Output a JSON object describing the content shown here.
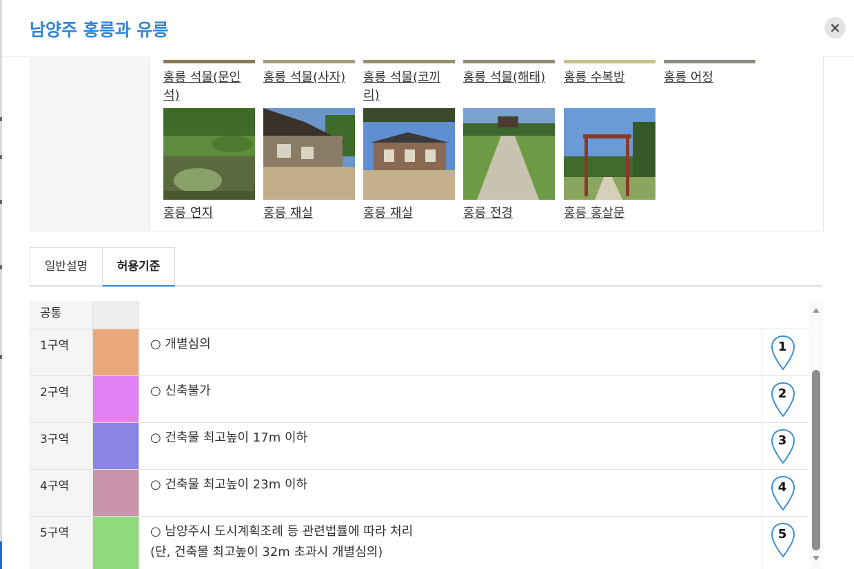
{
  "dialog": {
    "title": "남양주 홍릉과 유릉",
    "close_symbol": "×"
  },
  "gallery": {
    "row1": [
      {
        "caption": "홍릉 석물(문인\n석)"
      },
      {
        "caption": "홍릉 석물(사자)"
      },
      {
        "caption": "홍릉 석물(코끼\n리)"
      },
      {
        "caption": "홍릉 석물(해태)"
      },
      {
        "caption": "홍릉 수복방"
      },
      {
        "caption": "홍릉 어정"
      }
    ],
    "row2": [
      {
        "caption": "홍릉 연지"
      },
      {
        "caption": "홍릉 재실"
      },
      {
        "caption": "홍릉 재실"
      },
      {
        "caption": "홍릉 전경"
      },
      {
        "caption": "홍릉 홍살문"
      }
    ]
  },
  "tabs": [
    {
      "label": "일반설명",
      "active": false
    },
    {
      "label": "허용기준",
      "active": true
    }
  ],
  "criteria": {
    "rows": [
      {
        "zone": "공통",
        "color": "#eeeeee",
        "text": "",
        "marker": ""
      },
      {
        "zone": "1구역",
        "color": "#e8a87c",
        "text": "○ 개별심의",
        "marker": "1"
      },
      {
        "zone": "2구역",
        "color": "#e27ff2",
        "text": "○ 신축불가",
        "marker": "2"
      },
      {
        "zone": "3구역",
        "color": "#8a84e6",
        "text": "○ 건축물 최고높이 17m 이하",
        "marker": "3"
      },
      {
        "zone": "4구역",
        "color": "#c994a9",
        "text": "○ 건축물 최고높이 23m 이하",
        "marker": "4"
      },
      {
        "zone": "5구역",
        "color": "#8fdb7c",
        "text": "○ 남양주시 도시계획조례 등 관련법률에 따라 처리\n(단, 건축물 최고높이 32m 초과시 개별심의)",
        "marker": "5"
      }
    ]
  },
  "colors": {
    "accent": "#2e86d8",
    "pin_stroke": "#3a8fd6"
  },
  "icons": {
    "close": "close-icon",
    "marker": "map-pin-icon",
    "scroll_up": "arrow-up-icon",
    "scroll_down": "arrow-down-icon"
  }
}
